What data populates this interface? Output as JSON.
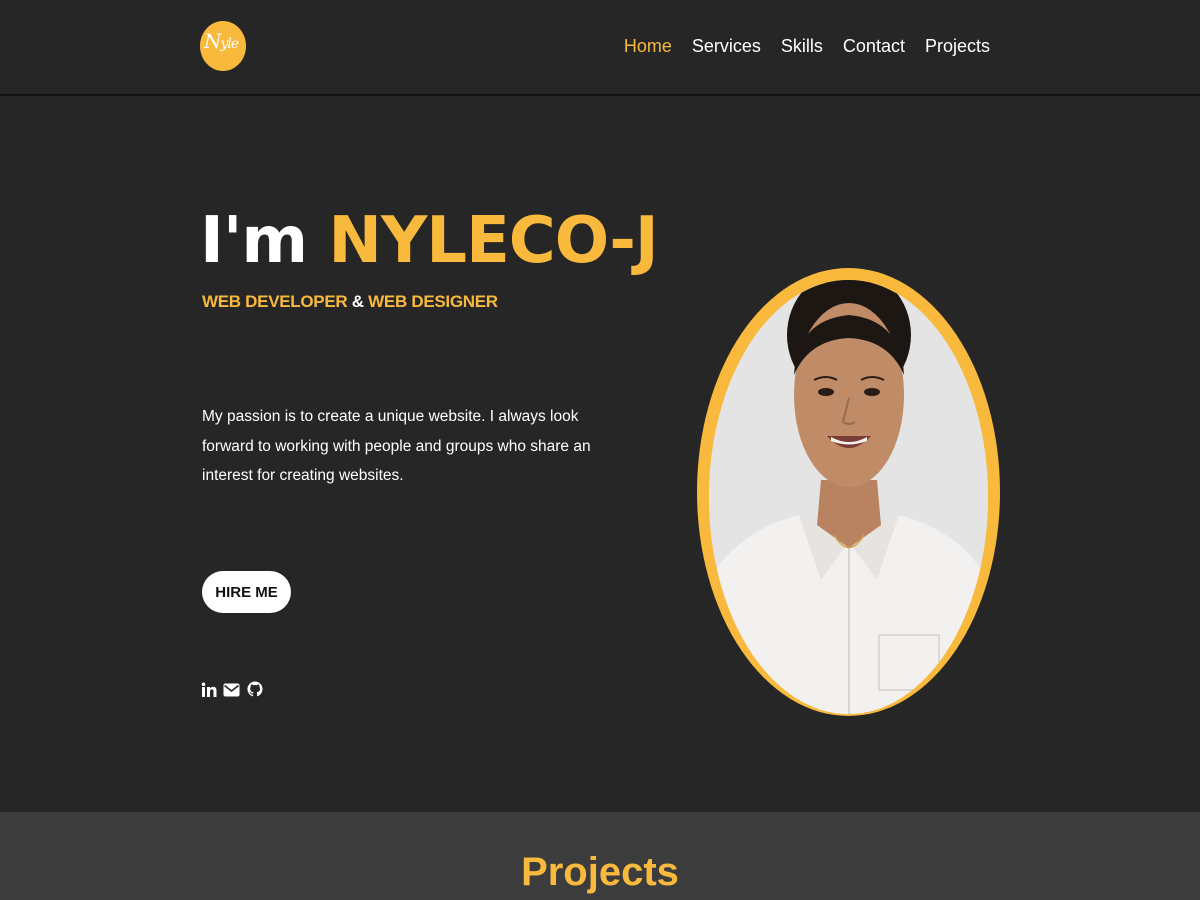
{
  "logo": {
    "initial": "N",
    "rest": "yle"
  },
  "nav": {
    "items": [
      {
        "label": "Home",
        "active": true
      },
      {
        "label": "Services",
        "active": false
      },
      {
        "label": "Skills",
        "active": false
      },
      {
        "label": "Contact",
        "active": false
      },
      {
        "label": "Projects",
        "active": false
      }
    ]
  },
  "hero": {
    "prefix": "I'm ",
    "name": "NYLECO-J",
    "role1": "WEB DEVELOPER",
    "amp": " & ",
    "role2": "WEB DESIGNER",
    "description": "My passion is to create a unique website. I always look forward to working with people and groups who share an interest for creating websites.",
    "button": "HIRE ME"
  },
  "socials": [
    "linkedin-icon",
    "mail-icon",
    "github-icon"
  ],
  "projects": {
    "title": "Projects"
  },
  "colors": {
    "accent": "#f8b93c",
    "background": "#262626",
    "section": "#3d3c3d"
  }
}
